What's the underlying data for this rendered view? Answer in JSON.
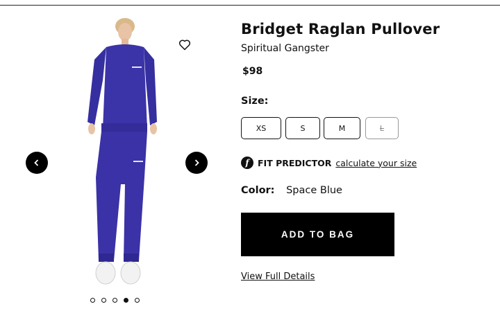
{
  "product": {
    "title": "Bridget Raglan Pullover",
    "brand": "Spiritual Gangster",
    "price": "$98"
  },
  "size": {
    "label": "Size:",
    "options": [
      {
        "label": "XS",
        "available": true
      },
      {
        "label": "S",
        "available": true
      },
      {
        "label": "M",
        "available": true
      },
      {
        "label": "L",
        "available": false
      }
    ]
  },
  "fit_predictor": {
    "icon": "f",
    "label": "FIT PREDICTOR",
    "link": "calculate your size"
  },
  "color": {
    "label": "Color:",
    "value": "Space Blue",
    "swatch": "#3b33a8"
  },
  "actions": {
    "add_to_bag": "ADD TO BAG",
    "view_details": "View Full Details"
  },
  "gallery": {
    "image_count": 5,
    "active_index": 3
  }
}
